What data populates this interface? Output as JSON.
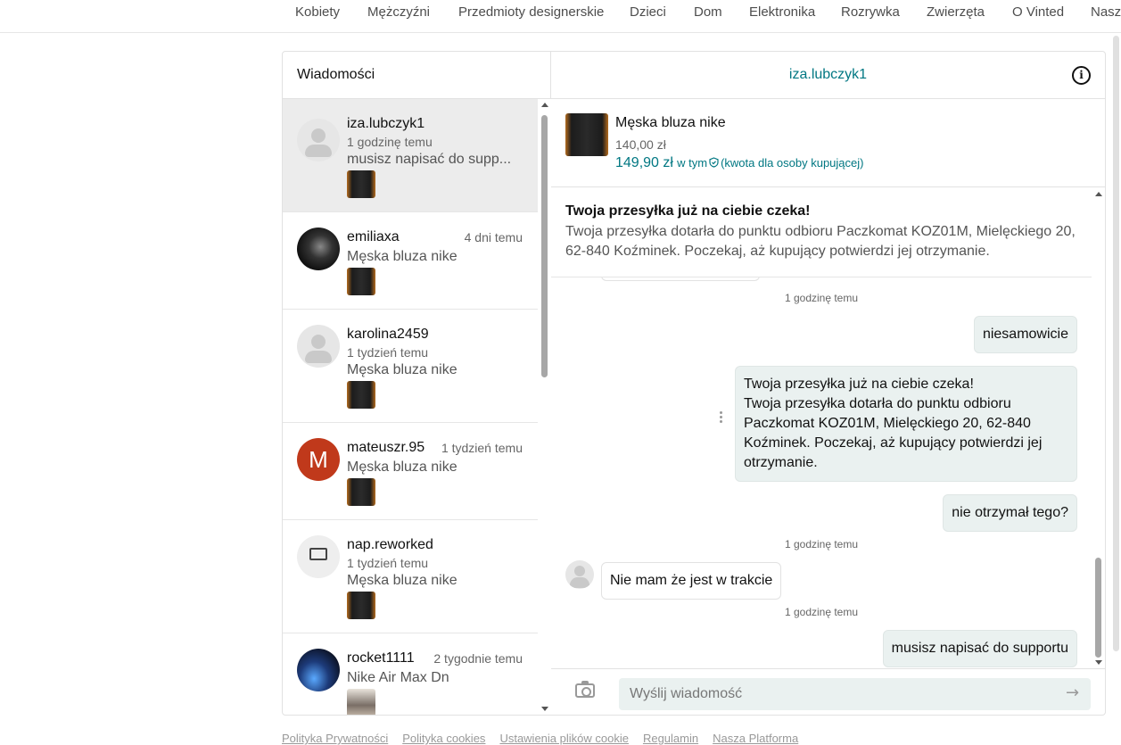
{
  "nav": {
    "items": [
      "Kobiety",
      "Mężczyźni",
      "Przedmioty designerskie",
      "Dzieci",
      "Dom",
      "Elektronika",
      "Rozrywka",
      "Zwierzęta",
      "O Vinted",
      "Nasz"
    ]
  },
  "sidebar": {
    "title": "Wiadomości",
    "conversations": [
      {
        "name": "iza.lubczyk1",
        "time": "1 godzinę temu",
        "message": "musisz napisać do supp..."
      },
      {
        "name": "emiliaxa",
        "time": "4 dni temu",
        "message": "Męska bluza nike"
      },
      {
        "name": "karolina2459",
        "time": "1 tydzień temu",
        "message": "Męska bluza nike"
      },
      {
        "name": "mateuszr.95",
        "time": "1 tydzień temu",
        "message": "Męska bluza nike",
        "avatar_letter": "M"
      },
      {
        "name": "nap.reworked",
        "time": "1 tydzień temu",
        "message": "Męska bluza nike"
      },
      {
        "name": "rocket1111",
        "time": "2 tygodnie temu",
        "message": "Nike Air Max Dn"
      }
    ]
  },
  "chat": {
    "username": "iza.lubczyk1",
    "info_icon": "i",
    "item": {
      "title": "Męska bluza nike",
      "price": "140,00 zł",
      "total_price": "149,90 zł",
      "total_suffix": "w tym",
      "total_note": "(kwota dla osoby kupującej)"
    },
    "banner": {
      "title": "Twoja przesyłka już na ciebie czeka!",
      "body": "Twoja przesyłka dotarła do punktu odbioru Paczkomat KOZ01M, Mielęckiego 20, 62-840 Koźminek. Poczekaj, aż kupujący potwierdzi jej otrzymanie."
    },
    "messages": {
      "ts1": "1 godzinę temu",
      "m1": "niesamowicie",
      "m2_line1": "Twoja przesyłka już na ciebie czeka!",
      "m2_line2": "Twoja przesyłka dotarła do punktu odbioru Paczkomat KOZ01M, Mielęckiego 20, 62-840 Koźminek. Poczekaj, aż kupujący potwierdzi jej otrzymanie.",
      "m3": "nie otrzymał tego?",
      "ts2": "1 godzinę temu",
      "m4": "Nie mam że jest w trakcie",
      "ts3": "1 godzinę temu",
      "m5": "musisz napisać do supportu"
    },
    "composer": {
      "placeholder": "Wyślij wiadomość",
      "send_icon": "→"
    }
  },
  "footer": {
    "links": [
      "Polityka Prywatności",
      "Polityka cookies",
      "Ustawienia plików cookie",
      "Regulamin",
      "Nasza Platforma"
    ]
  },
  "colors": {
    "accent": "#007782",
    "avatar_m": "#c0391b",
    "outgoing_bubble": "#eaf1f0"
  }
}
